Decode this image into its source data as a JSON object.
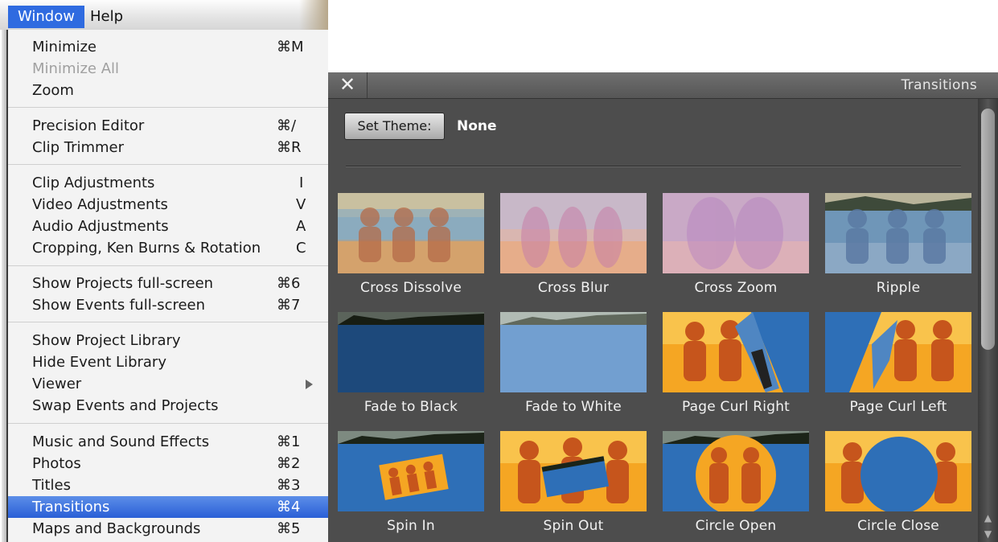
{
  "menubar": {
    "window_label": "Window",
    "help_label": "Help"
  },
  "window_menu": {
    "minimize": {
      "label": "Minimize",
      "shortcut": "⌘M"
    },
    "minimize_all": {
      "label": "Minimize All"
    },
    "zoom": {
      "label": "Zoom"
    },
    "precision_editor": {
      "label": "Precision Editor",
      "shortcut": "⌘/"
    },
    "clip_trimmer": {
      "label": "Clip Trimmer",
      "shortcut": "⌘R"
    },
    "clip_adjustments": {
      "label": "Clip Adjustments",
      "shortcut": "I"
    },
    "video_adjustments": {
      "label": "Video Adjustments",
      "shortcut": "V"
    },
    "audio_adjustments": {
      "label": "Audio Adjustments",
      "shortcut": "A"
    },
    "cropping": {
      "label": "Cropping, Ken Burns & Rotation",
      "shortcut": "C"
    },
    "projects_full": {
      "label": "Show Projects full-screen",
      "shortcut": "⌘6"
    },
    "events_full": {
      "label": "Show Events full-screen",
      "shortcut": "⌘7"
    },
    "project_library": {
      "label": "Show Project Library"
    },
    "hide_event_library": {
      "label": "Hide Event Library"
    },
    "viewer": {
      "label": "Viewer"
    },
    "swap": {
      "label": "Swap Events and Projects"
    },
    "music": {
      "label": "Music and Sound Effects",
      "shortcut": "⌘1"
    },
    "photos": {
      "label": "Photos",
      "shortcut": "⌘2"
    },
    "titles": {
      "label": "Titles",
      "shortcut": "⌘3"
    },
    "transitions": {
      "label": "Transitions",
      "shortcut": "⌘4"
    },
    "maps": {
      "label": "Maps and Backgrounds",
      "shortcut": "⌘5"
    }
  },
  "panel": {
    "close_glyph": "✕",
    "title": "Transitions",
    "set_theme_label": "Set Theme:",
    "theme_value": "None",
    "tiles": [
      {
        "label": "Cross Dissolve"
      },
      {
        "label": "Cross Blur"
      },
      {
        "label": "Cross Zoom"
      },
      {
        "label": "Ripple"
      },
      {
        "label": "Fade to Black"
      },
      {
        "label": "Fade to White"
      },
      {
        "label": "Page Curl Right"
      },
      {
        "label": "Page Curl Left"
      },
      {
        "label": "Spin In"
      },
      {
        "label": "Spin Out"
      },
      {
        "label": "Circle Open"
      },
      {
        "label": "Circle Close"
      }
    ]
  },
  "colors": {
    "menu_highlight": "#2f6be0",
    "panel_bg": "#4d4d4d",
    "water": "#2e6fb7",
    "sunset": "#f5a623"
  }
}
